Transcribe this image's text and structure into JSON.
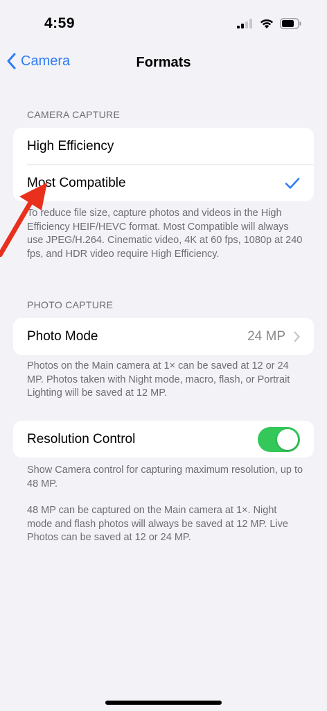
{
  "status_bar": {
    "time": "4:59",
    "icons": [
      "cellular-signal-icon",
      "wifi-icon",
      "battery-icon"
    ]
  },
  "nav": {
    "back_label": "Camera",
    "title": "Formats"
  },
  "camera_capture": {
    "header": "CAMERA CAPTURE",
    "options": [
      {
        "label": "High Efficiency",
        "selected": false
      },
      {
        "label": "Most Compatible",
        "selected": true
      }
    ],
    "footer": "To reduce file size, capture photos and videos in the High Efficiency HEIF/HEVC format. Most Compatible will always use JPEG/H.264. Cinematic video, 4K at 60 fps, 1080p at 240 fps, and HDR video require High Efficiency."
  },
  "photo_capture": {
    "header": "PHOTO CAPTURE",
    "photo_mode_label": "Photo Mode",
    "photo_mode_value": "24 MP",
    "footer": "Photos on the Main camera at 1× can be saved at 12 or 24 MP. Photos taken with Night mode, macro, flash, or Portrait Lighting will be saved at 12 MP."
  },
  "resolution_control": {
    "label": "Resolution Control",
    "enabled": true,
    "footer_1": "Show Camera control for capturing maximum resolution, up to 48 MP.",
    "footer_2": "48 MP can be captured on the Main camera at 1×. Night mode and flash photos will always be saved at 12 MP. Live Photos can be saved at 12 or 24 MP."
  },
  "colors": {
    "accent": "#2f7cf6",
    "toggle_on": "#34c759",
    "annotation": "#e8301c",
    "background": "#f2f2f7"
  }
}
